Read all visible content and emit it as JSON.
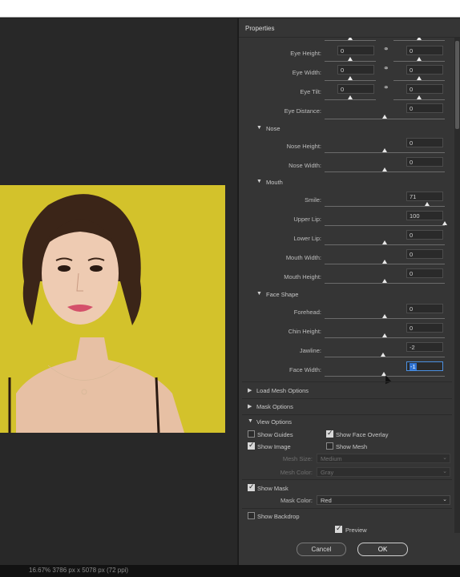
{
  "panel": {
    "title": "Properties"
  },
  "eyes": [
    {
      "label": "Eye Height:",
      "left": "0",
      "right": "0"
    },
    {
      "label": "Eye Width:",
      "left": "0",
      "right": "0"
    },
    {
      "label": "Eye Tilt:",
      "left": "0",
      "right": "0"
    },
    {
      "label": "Eye Distance:",
      "value": "0"
    }
  ],
  "nose": {
    "title": "Nose",
    "rows": [
      {
        "label": "Nose Height:",
        "value": "0"
      },
      {
        "label": "Nose Width:",
        "value": "0"
      }
    ]
  },
  "mouth": {
    "title": "Mouth",
    "rows": [
      {
        "label": "Smile:",
        "value": "71"
      },
      {
        "label": "Upper Lip:",
        "value": "100"
      },
      {
        "label": "Lower Lip:",
        "value": "0"
      },
      {
        "label": "Mouth Width:",
        "value": "0"
      },
      {
        "label": "Mouth Height:",
        "value": "0"
      }
    ]
  },
  "face_shape": {
    "title": "Face Shape",
    "rows": [
      {
        "label": "Forehead:",
        "value": "0"
      },
      {
        "label": "Chin Height:",
        "value": "0"
      },
      {
        "label": "Jawline:",
        "value": "-2"
      },
      {
        "label": "Face Width:",
        "value": "-1"
      }
    ]
  },
  "collapsed_sections": [
    "Load Mesh Options",
    "Mask Options"
  ],
  "view_options": {
    "title": "View Options",
    "show_guides": "Show Guides",
    "show_face_overlay": "Show Face Overlay",
    "show_image": "Show Image",
    "show_mesh": "Show Mesh",
    "mesh_size_label": "Mesh Size:",
    "mesh_size_value": "Medium",
    "mesh_color_label": "Mesh Color:",
    "mesh_color_value": "Gray",
    "show_mask": "Show Mask",
    "mask_color_label": "Mask Color:",
    "mask_color_value": "Red",
    "show_backdrop": "Show Backdrop"
  },
  "preview_label": "Preview",
  "buttons": {
    "cancel": "Cancel",
    "ok": "OK"
  },
  "status_text": "16.67% 3786 px x 5078 px (72 ppi)",
  "colors": {
    "background_yellow": "#d8c62e",
    "accent_blue": "#2e72d2",
    "panel_bg": "#353535"
  }
}
